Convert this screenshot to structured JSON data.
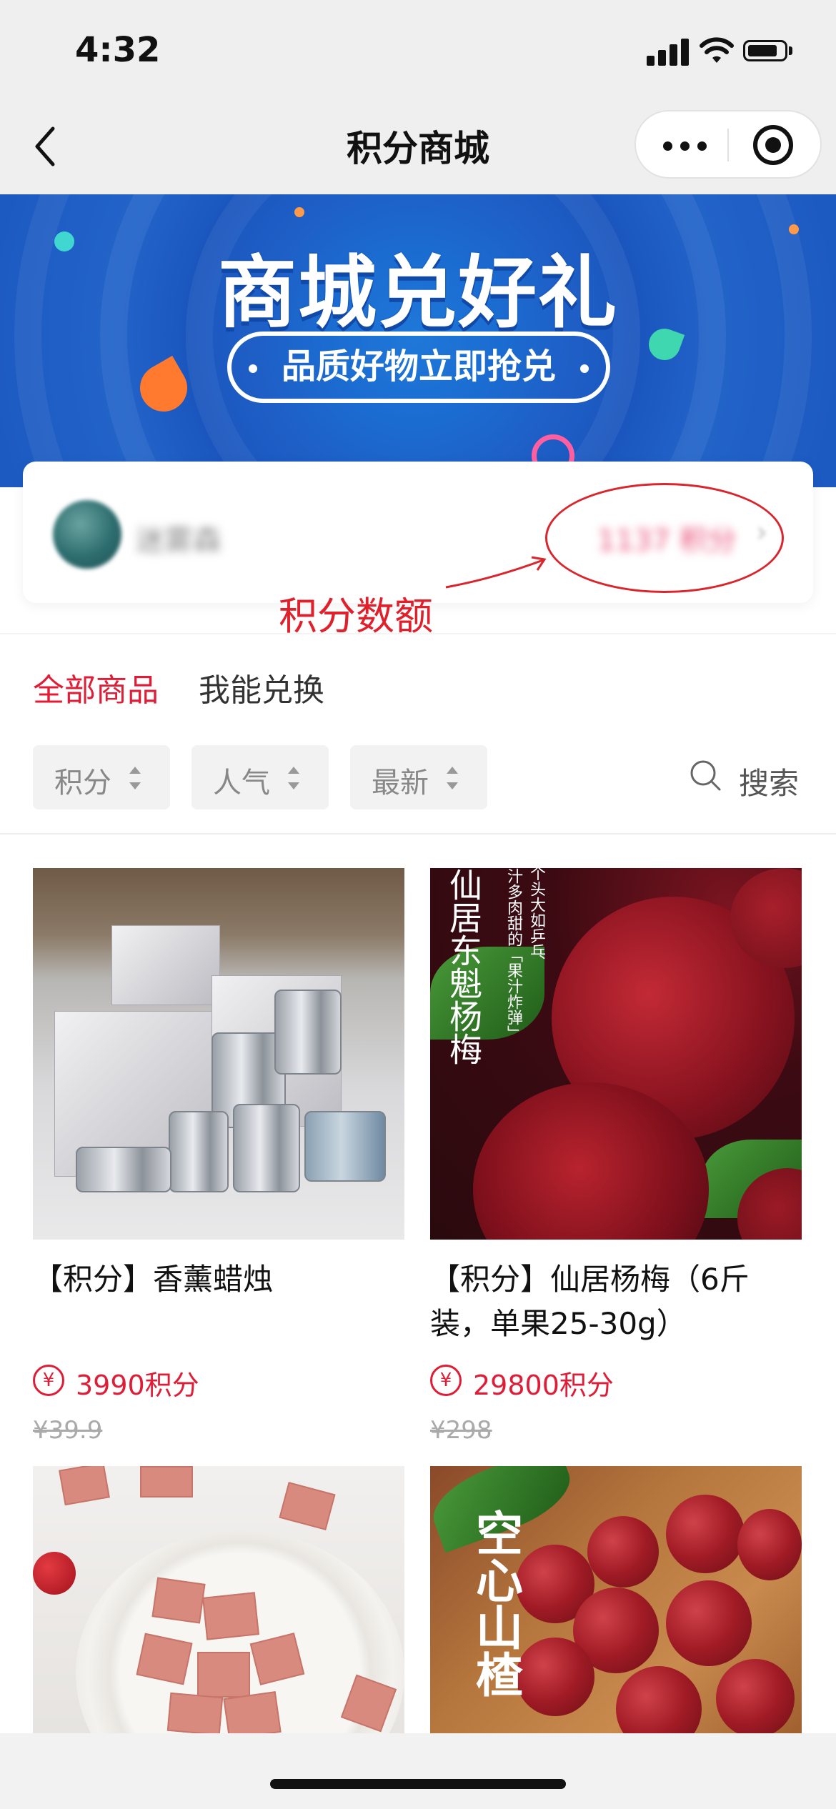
{
  "status_bar": {
    "time": "4:32"
  },
  "nav": {
    "title": "积分商城"
  },
  "banner": {
    "title": "商城兑好礼",
    "subtitle": "品质好物立即抢兑"
  },
  "user": {
    "nickname": "迷雾森",
    "points_value": "1137 积分",
    "chevron": "›"
  },
  "annotation": {
    "label": "积分数额",
    "color": "#d9252b"
  },
  "tabs": [
    {
      "label": "全部商品",
      "active": true
    },
    {
      "label": "我能兑换",
      "active": false
    }
  ],
  "sort": {
    "options": [
      {
        "label": "积分"
      },
      {
        "label": "人气"
      },
      {
        "label": "最新"
      }
    ],
    "search_label": "搜索"
  },
  "products": [
    {
      "name": "【积分】香薰蜡烛",
      "points": "3990积分",
      "original_price": "¥39.9",
      "image": "aroma-candles"
    },
    {
      "name": "【积分】仙居杨梅（6斤装，单果25-30g）",
      "points": "29800积分",
      "original_price": "¥298",
      "image": "bayberries",
      "image_text": {
        "main": "仙居东魁杨梅",
        "side1": "个头大如乒乓",
        "side2": "汁多肉甜的「果汁炸弹」"
      }
    },
    {
      "name": "",
      "points": "",
      "original_price": "",
      "image": "fruit-leather"
    },
    {
      "name": "",
      "points": "",
      "original_price": "",
      "image": "hawthorn",
      "image_text": {
        "main": "空心山楂"
      }
    }
  ],
  "colors": {
    "accent": "#e01d37",
    "banner_blue": "#1e5fc6",
    "page_bg": "#ffffff",
    "nav_bg": "#efefef"
  }
}
